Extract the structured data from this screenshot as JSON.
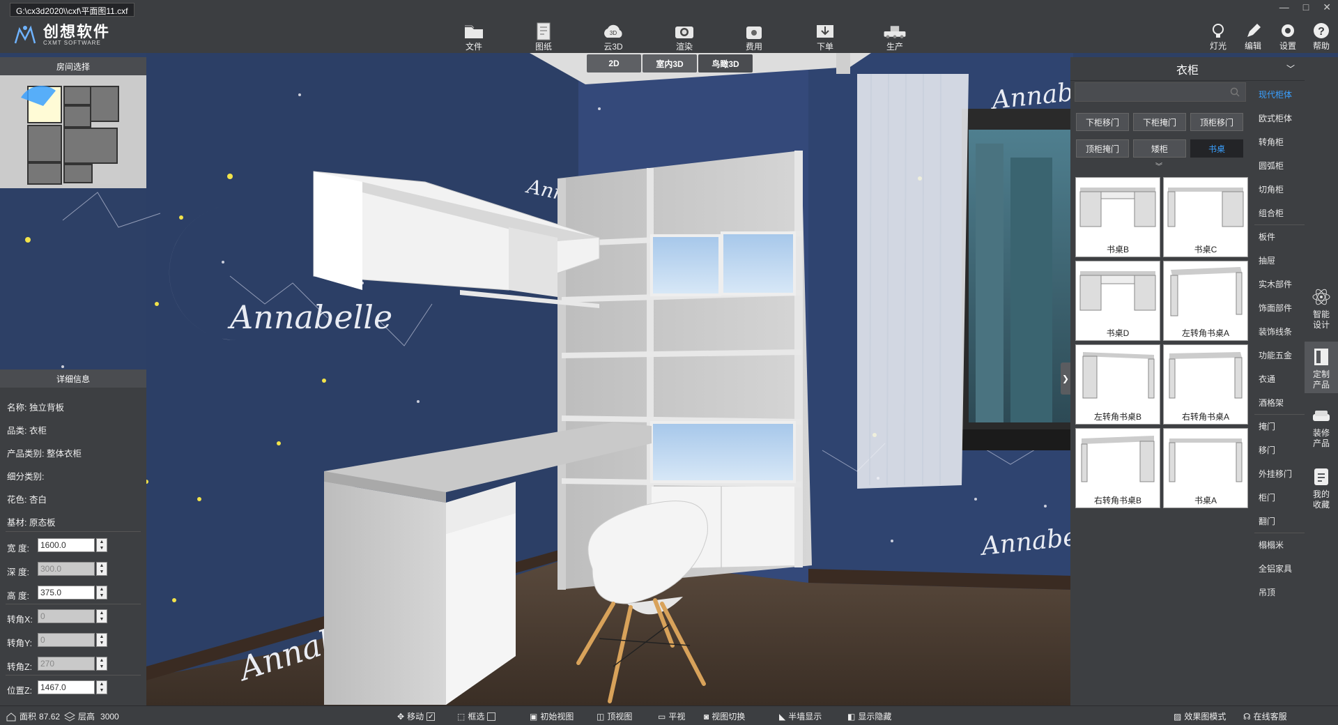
{
  "window": {
    "title_path": "G:\\cx3d2020\\\\cxf\\平面图11.cxf",
    "controls": [
      "—",
      "□",
      "✕"
    ]
  },
  "brand": {
    "name_cn": "创想软件",
    "name_en": "CXMT SOFTWARE"
  },
  "toolbar": {
    "items": [
      {
        "label": "文件",
        "icon": "folder-icon"
      },
      {
        "label": "图纸",
        "icon": "drawing-icon"
      },
      {
        "label": "云3D",
        "icon": "cloud-3d-icon",
        "badge": "3D"
      },
      {
        "label": "渲染",
        "icon": "camera-icon"
      },
      {
        "label": "费用",
        "icon": "wallet-icon"
      },
      {
        "label": "下单",
        "icon": "order-download-icon"
      },
      {
        "label": "生产",
        "icon": "production-icon"
      }
    ],
    "right": [
      {
        "label": "灯光",
        "icon": "light-icon"
      },
      {
        "label": "编辑",
        "icon": "edit-icon"
      },
      {
        "label": "设置",
        "icon": "gear-icon"
      },
      {
        "label": "帮助",
        "icon": "help-icon"
      }
    ]
  },
  "view_tabs": {
    "items": [
      "2D",
      "室内3D",
      "鸟瞰3D"
    ],
    "selected": "鸟瞰3D"
  },
  "room_select": {
    "title": "房间选择"
  },
  "details": {
    "title": "详细信息",
    "name_label": "名称:",
    "name_value": "独立背板",
    "category_label": "品类:",
    "category_value": "衣柜",
    "product_type_label": "产品类别:",
    "product_type_value": "整体衣柜",
    "sub_type_label": "细分类别:",
    "sub_type_value": "",
    "pattern_label": "花色:",
    "pattern_value": "杏白",
    "material_label": "基材:",
    "material_value": "原态板",
    "width_label": "宽 度:",
    "width_value": "1600.0",
    "depth_label": "深 度:",
    "depth_value": "300.0",
    "height_label": "高 度:",
    "height_value": "375.0",
    "rot_x_label": "转角X:",
    "rot_x_value": "0",
    "rot_y_label": "转角Y:",
    "rot_y_value": "0",
    "rot_z_label": "转角Z:",
    "rot_z_value": "270",
    "pos_z_label": "位置Z:",
    "pos_z_value": "1467.0"
  },
  "catalog": {
    "title": "衣柜",
    "search_placeholder": "",
    "filters": [
      "下柜移门",
      "下柜掩门",
      "顶柜移门",
      "顶柜掩门",
      "矮柜",
      "书桌"
    ],
    "selected_filter": "书桌",
    "products": [
      "书桌B",
      "书桌C",
      "书桌D",
      "左转角书桌A",
      "左转角书桌B",
      "右转角书桌A",
      "右转角书桌B",
      "书桌A"
    ],
    "categories": [
      {
        "label": "现代柜体",
        "selected": true
      },
      {
        "label": "欧式柜体"
      },
      {
        "label": "转角柜"
      },
      {
        "label": "圆弧柜"
      },
      {
        "label": "切角柜"
      },
      {
        "label": "组合柜"
      },
      {
        "label": "板件",
        "divider": true
      },
      {
        "label": "抽屉"
      },
      {
        "label": "实木部件"
      },
      {
        "label": "饰面部件"
      },
      {
        "label": "装饰线条"
      },
      {
        "label": "功能五金"
      },
      {
        "label": "衣通"
      },
      {
        "label": "酒格架"
      },
      {
        "label": "掩门",
        "divider": true
      },
      {
        "label": "移门"
      },
      {
        "label": "外挂移门"
      },
      {
        "label": "柜门"
      },
      {
        "label": "翻门"
      },
      {
        "label": "榻榻米",
        "divider": true
      },
      {
        "label": "全铝家具"
      },
      {
        "label": "吊顶"
      }
    ]
  },
  "sidebar": [
    {
      "label_1": "智能",
      "label_2": "设计",
      "icon": "atom-icon"
    },
    {
      "label_1": "定制",
      "label_2": "产品",
      "icon": "custom-cabinet-icon",
      "selected": true
    },
    {
      "label_1": "装修",
      "label_2": "产品",
      "icon": "sofa-icon"
    },
    {
      "label_1": "我的",
      "label_2": "收藏",
      "icon": "favorites-icon"
    }
  ],
  "status": {
    "area_label": "面积",
    "area_value": "87.62",
    "floor_label": "层高",
    "floor_value": "3000",
    "move_label": "移动",
    "select_label": "框选",
    "initial_view": "初始视图",
    "top_view": "顶视图",
    "level_view": "平视",
    "view_switch": "视图切换",
    "half_wall": "半墙显示",
    "show_hide": "显示隐藏",
    "render_mode": "效果图模式",
    "support": "在线客服"
  },
  "scene": {
    "wallpaper_text": "Annabelle"
  },
  "colors": {
    "accent": "#3aa0ff",
    "wall": "#2b3e63",
    "panel": "#3d3f42",
    "toolbar": "#3c3e41"
  }
}
